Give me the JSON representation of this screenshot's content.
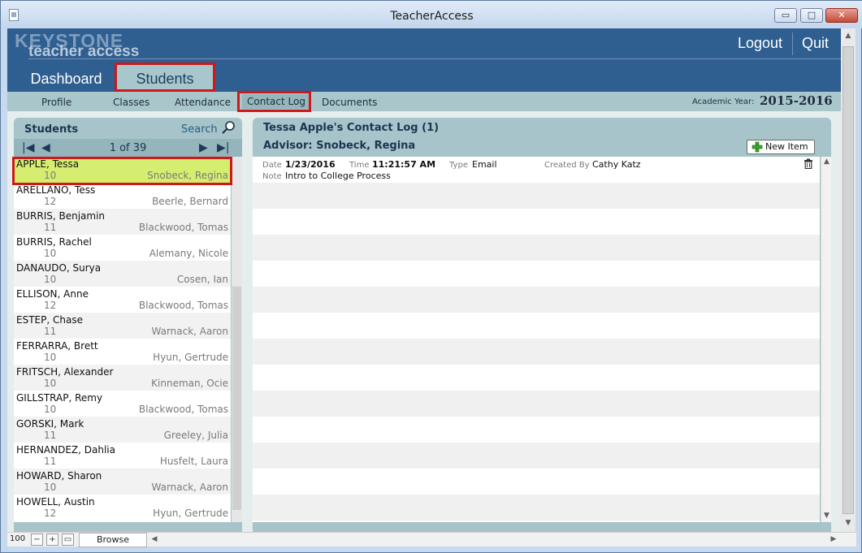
{
  "window": {
    "title": "TeacherAccess",
    "min_label": "▭",
    "max_label": "□",
    "close_label": "✕"
  },
  "brand": {
    "top": "KEYSTONE",
    "bottom": "teacher access"
  },
  "header": {
    "logout": "Logout",
    "quit": "Quit"
  },
  "main_tabs": {
    "dashboard": "Dashboard",
    "students": "Students"
  },
  "sub_nav": {
    "profile": "Profile",
    "classes": "Classes",
    "attendance": "Attendance",
    "contact_log": "Contact Log",
    "documents": "Documents"
  },
  "academic_year": {
    "label": "Academic Year:",
    "value": "2015-2016"
  },
  "students_panel": {
    "title": "Students",
    "search_label": "Search",
    "page_count": "1 of 39",
    "rows": [
      {
        "name": "APPLE, Tessa",
        "grade": "10",
        "advisor": "Snobeck, Regina"
      },
      {
        "name": "ARELLANO, Tess",
        "grade": "12",
        "advisor": "Beerle, Bernard"
      },
      {
        "name": "BURRIS, Benjamin",
        "grade": "11",
        "advisor": "Blackwood, Tomas"
      },
      {
        "name": "BURRIS, Rachel",
        "grade": "10",
        "advisor": "Alemany, Nicole"
      },
      {
        "name": "DANAUDO, Surya",
        "grade": "10",
        "advisor": "Cosen, Ian"
      },
      {
        "name": "ELLISON, Anne",
        "grade": "12",
        "advisor": "Blackwood, Tomas"
      },
      {
        "name": "ESTEP, Chase",
        "grade": "11",
        "advisor": "Warnack, Aaron"
      },
      {
        "name": "FERRARRA, Brett",
        "grade": "10",
        "advisor": "Hyun, Gertrude"
      },
      {
        "name": "FRITSCH, Alexander",
        "grade": "10",
        "advisor": "Kinneman, Ocie"
      },
      {
        "name": "GILLSTRAP, Remy",
        "grade": "10",
        "advisor": "Blackwood, Tomas"
      },
      {
        "name": "GORSKI, Mark",
        "grade": "11",
        "advisor": "Greeley, Julia"
      },
      {
        "name": "HERNANDEZ, Dahlia",
        "grade": "11",
        "advisor": "Husfelt, Laura"
      },
      {
        "name": "HOWARD, Sharon",
        "grade": "10",
        "advisor": "Warnack, Aaron"
      },
      {
        "name": "HOWELL, Austin",
        "grade": "12",
        "advisor": "Hyun, Gertrude"
      }
    ]
  },
  "contact_log": {
    "title": "Tessa Apple's Contact Log (1)",
    "advisor": "Advisor: Snobeck, Regina",
    "new_item_label": "New Item",
    "entry": {
      "date_label": "Date",
      "date": "1/23/2016",
      "time_label": "Time",
      "time": "11:21:57 AM",
      "type_label": "Type",
      "type": "Email",
      "created_by_label": "Created By",
      "created_by": "Cathy Katz",
      "note_label": "Note",
      "note": "Intro to College Process"
    }
  },
  "status_bar": {
    "zoom": "100",
    "mode": "Browse"
  },
  "colors": {
    "header": "#2f5e90",
    "subnav": "#a9c7cb",
    "selected_row": "#d6ee6f",
    "highlight_box": "#d01818"
  }
}
